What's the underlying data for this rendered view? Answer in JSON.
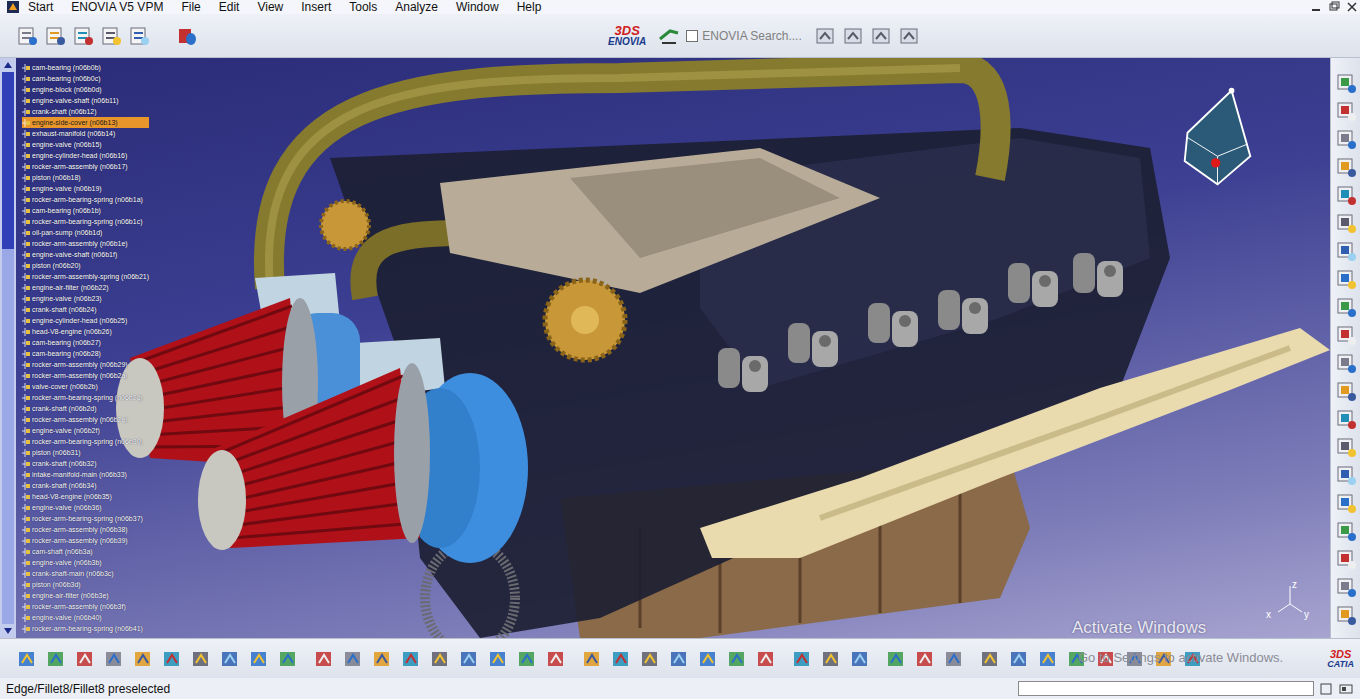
{
  "window": {
    "title": "ENOVIA V5 VPM"
  },
  "menu": [
    "Start",
    "ENOVIA V5 VPM",
    "File",
    "Edit",
    "View",
    "Insert",
    "Tools",
    "Analyze",
    "Window",
    "Help"
  ],
  "toolbar": {
    "logo": {
      "mark": "3DS",
      "name": "ENOVIA"
    },
    "search": {
      "label": "ENOVIA Search....",
      "checked": false,
      "disabled": true
    }
  },
  "tree": {
    "scroll": {
      "level": 0.32
    },
    "items": [
      {
        "label": "cam-bearing (n06b0b)",
        "selected": false
      },
      {
        "label": "cam-bearing (n06b0c)",
        "selected": false
      },
      {
        "label": "engine-block (n06b0d)",
        "selected": false
      },
      {
        "label": "engine-valve-shaft (n06b11)",
        "selected": false
      },
      {
        "label": "crank-shaft (n06b12)",
        "selected": false
      },
      {
        "label": "engine-side-cover (n06b13)",
        "selected": true
      },
      {
        "label": "exhaust-manifold (n06b14)",
        "selected": false
      },
      {
        "label": "engine-valve (n06b15)",
        "selected": false
      },
      {
        "label": "engine-cylinder-head (n06b16)",
        "selected": false
      },
      {
        "label": "rocker-arm-assembly (n06b17)",
        "selected": false
      },
      {
        "label": "piston (n06b18)",
        "selected": false
      },
      {
        "label": "engine-valve (n06b19)",
        "selected": false
      },
      {
        "label": "rocker-arm-bearing-spring (n06b1a)",
        "selected": false
      },
      {
        "label": "cam-bearing (n06b1b)",
        "selected": false
      },
      {
        "label": "rocker-arm-bearing-spring (n06b1c)",
        "selected": false
      },
      {
        "label": "oil-pan-sump (n06b1d)",
        "selected": false
      },
      {
        "label": "rocker-arm-assembly (n06b1e)",
        "selected": false
      },
      {
        "label": "engine-valve-shaft (n06b1f)",
        "selected": false
      },
      {
        "label": "piston (n06b20)",
        "selected": false
      },
      {
        "label": "rocker-arm-assembly-spring (n06b21)",
        "selected": false
      },
      {
        "label": "engine-air-filter (n06b22)",
        "selected": false
      },
      {
        "label": "engine-valve (n06b23)",
        "selected": false
      },
      {
        "label": "crank-shaft (n06b24)",
        "selected": false
      },
      {
        "label": "engine-cylinder-head (n06b25)",
        "selected": false
      },
      {
        "label": "head-V8-engine (n06b26)",
        "selected": false
      },
      {
        "label": "cam-bearing (n06b27)",
        "selected": false
      },
      {
        "label": "cam-bearing (n06b28)",
        "selected": false
      },
      {
        "label": "rocker-arm-assembly (n06b29)",
        "selected": false
      },
      {
        "label": "rocker-arm-assembly (n06b2a)",
        "selected": false
      },
      {
        "label": "valve-cover (n06b2b)",
        "selected": false
      },
      {
        "label": "rocker-arm-bearing-spring (n06b2c)",
        "selected": false
      },
      {
        "label": "crank-shaft (n06b2d)",
        "selected": false
      },
      {
        "label": "rocker-arm-assembly (n06b2e)",
        "selected": false
      },
      {
        "label": "engine-valve (n06b2f)",
        "selected": false
      },
      {
        "label": "rocker-arm-bearing-spring (n06b30)",
        "selected": false
      },
      {
        "label": "piston (n06b31)",
        "selected": false
      },
      {
        "label": "crank-shaft (n06b32)",
        "selected": false
      },
      {
        "label": "intake-manifold-main (n06b33)",
        "selected": false
      },
      {
        "label": "crank-shaft (n06b34)",
        "selected": false
      },
      {
        "label": "head-V8-engine (n06b35)",
        "selected": false
      },
      {
        "label": "engine-valve (n06b36)",
        "selected": false
      },
      {
        "label": "rocker-arm-bearing-spring (n06b37)",
        "selected": false
      },
      {
        "label": "rocker-arm-assembly (n06b38)",
        "selected": false
      },
      {
        "label": "rocker-arm-assembly (n06b39)",
        "selected": false
      },
      {
        "label": "cam-shaft (n06b3a)",
        "selected": false
      },
      {
        "label": "engine-valve (n06b3b)",
        "selected": false
      },
      {
        "label": "crank-shaft-main (n06b3c)",
        "selected": false
      },
      {
        "label": "piston (n06b3d)",
        "selected": false
      },
      {
        "label": "engine-air-filter (n06b3e)",
        "selected": false
      },
      {
        "label": "rocker-arm-assembly (n06b3f)",
        "selected": false
      },
      {
        "label": "engine-valve (n06b40)",
        "selected": false
      },
      {
        "label": "rocker-arm-bearing-spring (n06b41)",
        "selected": false
      }
    ]
  },
  "viewport": {
    "axes": [
      "x",
      "y",
      "z"
    ],
    "watermark": "Activate Windows"
  },
  "bottom_bar": {
    "logo": {
      "mark": "3DS",
      "name": "CATIA"
    },
    "watermark": "Go to Settings to activate Windows."
  },
  "status_bar": {
    "message": "Edge/Fillet8/Fillet8 preselected",
    "input": ""
  }
}
